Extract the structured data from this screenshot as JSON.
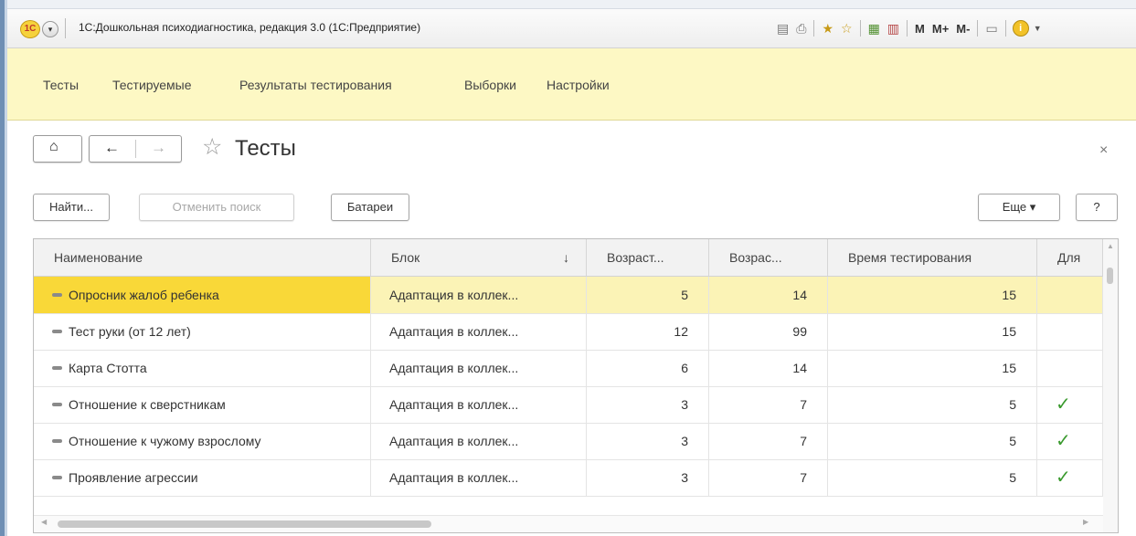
{
  "window": {
    "title": "1С:Дошкольная психодиагностика, редакция 3.0  (1С:Предприятие)",
    "logo_text": "1С",
    "toolbar": {
      "icons": [
        "save-icon",
        "print-icon",
        "favorites-add-icon",
        "favorites-icon",
        "calculator-icon",
        "calendar-icon",
        "m-icon",
        "m-plus-icon",
        "m-minus-icon",
        "panel-icon",
        "info-icon"
      ],
      "m_label": "M",
      "m_plus_label": "M+",
      "m_minus_label": "M-"
    }
  },
  "sections": [
    "Тесты",
    "Тестируемые",
    "Результаты тестирования",
    "Выборки",
    "Настройки"
  ],
  "form": {
    "title": "Тесты",
    "close_glyph": "×"
  },
  "toolbar": {
    "find_label": "Найти...",
    "cancel_search_label": "Отменить поиск",
    "batteries_label": "Батареи",
    "more_label": "Еще ▾",
    "help_label": "?"
  },
  "table": {
    "columns": [
      "Наименование",
      "Блок",
      "Возраст...",
      "Возрас...",
      "Время тестирования",
      "Для"
    ],
    "sort_indicator": "↓",
    "rows": [
      {
        "name": "Опросник жалоб ребенка",
        "block": "Адаптация в коллек...",
        "age_from": "5",
        "age_to": "14",
        "time": "15",
        "flag": ""
      },
      {
        "name": "Тест руки (от 12 лет)",
        "block": "Адаптация в коллек...",
        "age_from": "12",
        "age_to": "99",
        "time": "15",
        "flag": ""
      },
      {
        "name": "Карта Стотта",
        "block": "Адаптация в коллек...",
        "age_from": "6",
        "age_to": "14",
        "time": "15",
        "flag": ""
      },
      {
        "name": "Отношение к сверстникам",
        "block": "Адаптация в коллек...",
        "age_from": "3",
        "age_to": "7",
        "time": "5",
        "flag": "✓"
      },
      {
        "name": "Отношение к чужому взрослому",
        "block": "Адаптация в коллек...",
        "age_from": "3",
        "age_to": "7",
        "time": "5",
        "flag": "✓"
      },
      {
        "name": "Проявление агрессии",
        "block": "Адаптация в коллек...",
        "age_from": "3",
        "age_to": "7",
        "time": "5",
        "flag": "✓"
      }
    ],
    "selected_row": 0
  },
  "colors": {
    "sections_bg": "#fdf8c4",
    "selected_row": "#fbf3b6",
    "selected_cell": "#f9d838",
    "check": "#3a9a2e"
  }
}
